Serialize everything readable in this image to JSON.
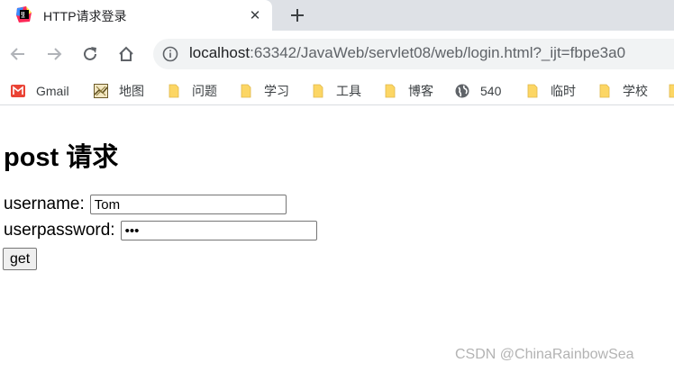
{
  "browser": {
    "tab": {
      "title": "HTTP请求登录",
      "close_glyph": "✕",
      "favicon": "jetbrains-icon"
    },
    "new_tab_icon": "plus-icon",
    "nav": {
      "back_icon": "arrow-left-icon",
      "forward_icon": "arrow-right-icon",
      "reload_icon": "reload-icon",
      "home_icon": "home-icon"
    },
    "address": {
      "host": "localhost",
      "rest": ":63342/JavaWeb/servlet08/web/login.html?_ijt=fbpe3a0",
      "info_icon": "info-icon"
    },
    "bookmarks": [
      {
        "label": "Gmail",
        "icon": "gmail-icon"
      },
      {
        "label": "地图",
        "icon": "map-icon"
      },
      {
        "label": "问题",
        "icon": "folder-icon"
      },
      {
        "label": "学习",
        "icon": "folder-icon"
      },
      {
        "label": "工具",
        "icon": "folder-icon"
      },
      {
        "label": "博客",
        "icon": "folder-icon"
      },
      {
        "label": "540",
        "icon": "globe-icon"
      },
      {
        "label": "临时",
        "icon": "folder-icon"
      },
      {
        "label": "学校",
        "icon": "folder-icon"
      }
    ]
  },
  "page": {
    "heading": "post 请求",
    "username_label": "username:",
    "username_value": "Tom",
    "password_label": "userpassword:",
    "password_value": "•••",
    "submit_label": "get"
  },
  "watermark": "CSDN @ChinaRainbowSea",
  "colors": {
    "tabstrip_bg": "#dee1e6",
    "omnibox_bg": "#f1f3f4",
    "folder_yellow": "#fcd664",
    "gmail_red": "#ea4335"
  }
}
